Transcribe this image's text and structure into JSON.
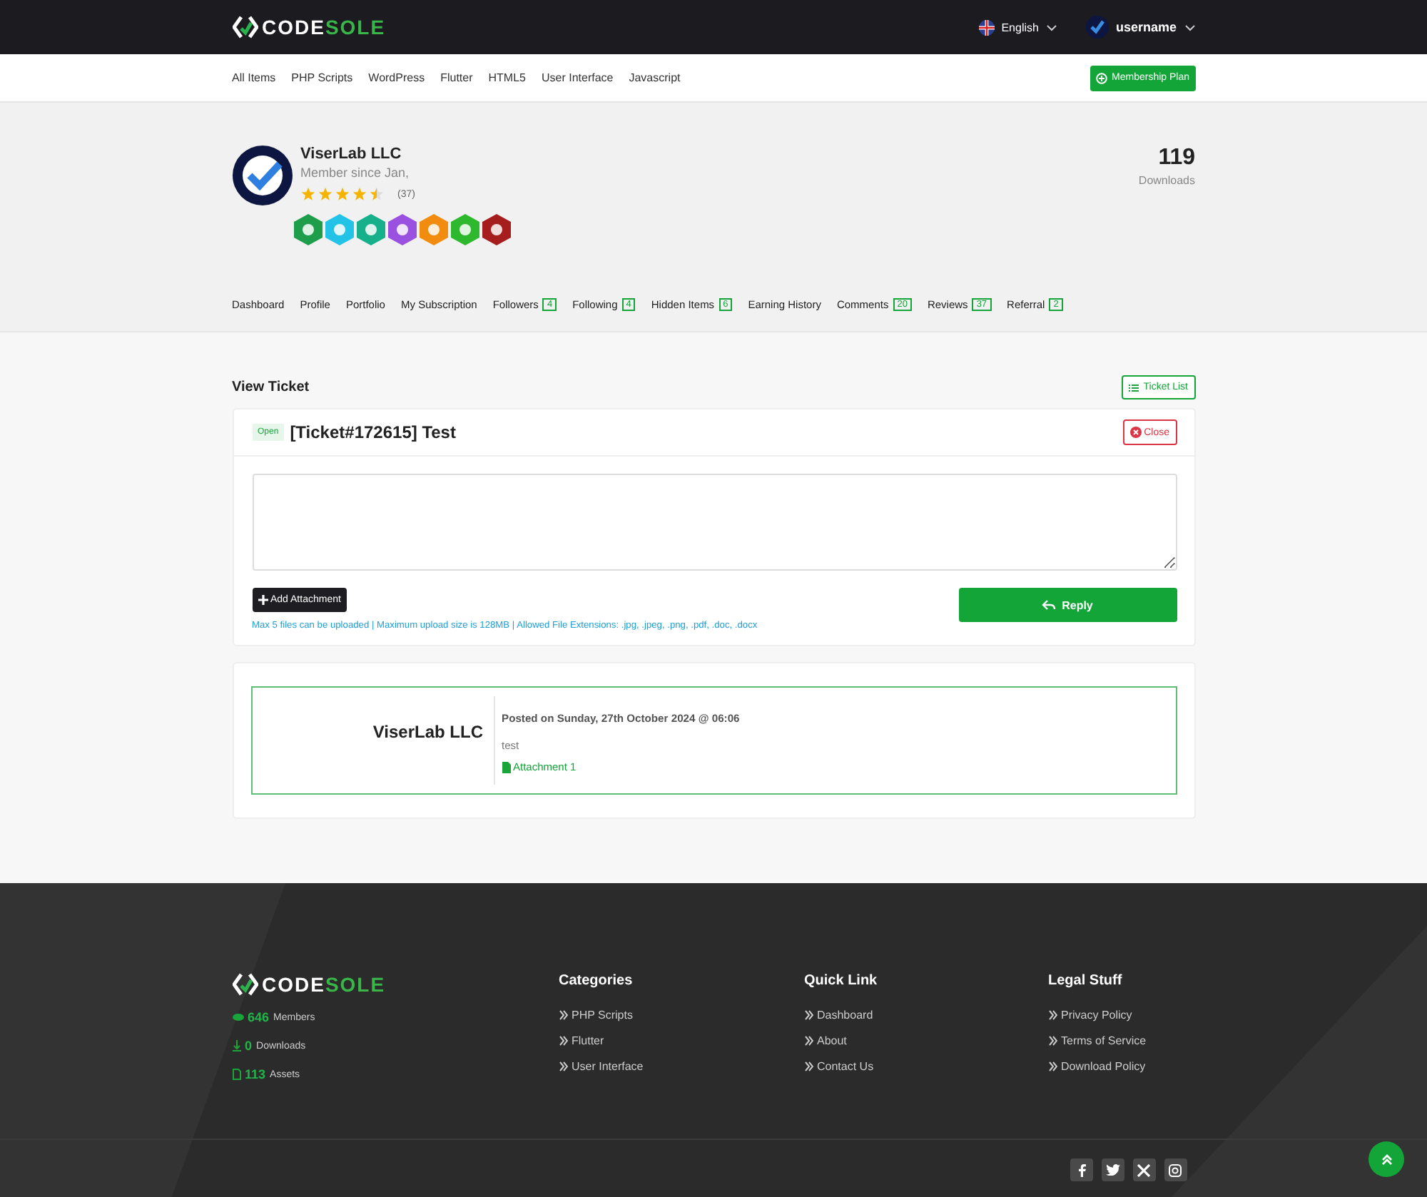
{
  "header": {
    "logo": [
      "CODE",
      "SOLE"
    ],
    "language": "English",
    "user": "username"
  },
  "nav": {
    "items": [
      "All Items",
      "PHP Scripts",
      "WordPress",
      "Flutter",
      "HTML5",
      "User Interface",
      "Javascript"
    ],
    "membership_button": "Membership Plan"
  },
  "profile": {
    "name": "ViserLab LLC",
    "member_since": "Member since Jan,",
    "stars": 4.5,
    "rating_count": "(37)",
    "badges": [
      {
        "color": "#1e9e4a"
      },
      {
        "color": "#22c3e6"
      },
      {
        "color": "#16b08a"
      },
      {
        "color": "#9b51e0"
      },
      {
        "color": "#f28c0f"
      },
      {
        "color": "#2eb82e"
      },
      {
        "color": "#a51d1d"
      }
    ],
    "downloads": "119",
    "downloads_label": "Downloads"
  },
  "tabs": [
    {
      "label": "Dashboard"
    },
    {
      "label": "Profile"
    },
    {
      "label": "Portfolio"
    },
    {
      "label": "My Subscription"
    },
    {
      "label": "Followers",
      "count": "4"
    },
    {
      "label": "Following",
      "count": "4"
    },
    {
      "label": "Hidden Items",
      "count": "6"
    },
    {
      "label": "Earning History"
    },
    {
      "label": "Comments",
      "count": "20"
    },
    {
      "label": "Reviews",
      "count": "37"
    },
    {
      "label": "Referral",
      "count": "2"
    }
  ],
  "ticket": {
    "page_title": "View Ticket",
    "list_button": "Ticket List",
    "status": "Open",
    "title": "[Ticket#172615] Test",
    "close_button": "Close",
    "add_attachment": "Add Attachment",
    "reply_button": "Reply",
    "upload_note": "Max 5 files can be uploaded | Maximum upload size is 128MB | Allowed File Extensions: .jpg, .jpeg, .png, .pdf, .doc, .docx"
  },
  "message": {
    "author": "ViserLab LLC",
    "posted": "Posted on Sunday, 27th October 2024 @ 06:06",
    "body": "test",
    "attachment": "Attachment 1"
  },
  "footer": {
    "logo": [
      "CODE",
      "SOLE"
    ],
    "stats": [
      {
        "kind": "members",
        "value": "646",
        "label": "Members"
      },
      {
        "kind": "downloads",
        "value": "0",
        "label": "Downloads"
      },
      {
        "kind": "assets",
        "value": "113",
        "label": "Assets"
      }
    ],
    "columns": [
      {
        "title": "Categories",
        "links": [
          "PHP Scripts",
          "Flutter",
          "User Interface"
        ]
      },
      {
        "title": "Quick Link",
        "links": [
          "Dashboard",
          "About",
          "Contact Us"
        ]
      },
      {
        "title": "Legal Stuff",
        "links": [
          "Privacy Policy",
          "Terms of Service",
          "Download Policy"
        ]
      }
    ],
    "social": [
      {
        "kind": "facebook"
      },
      {
        "kind": "twitter"
      },
      {
        "kind": "x"
      },
      {
        "kind": "instagram"
      }
    ]
  }
}
